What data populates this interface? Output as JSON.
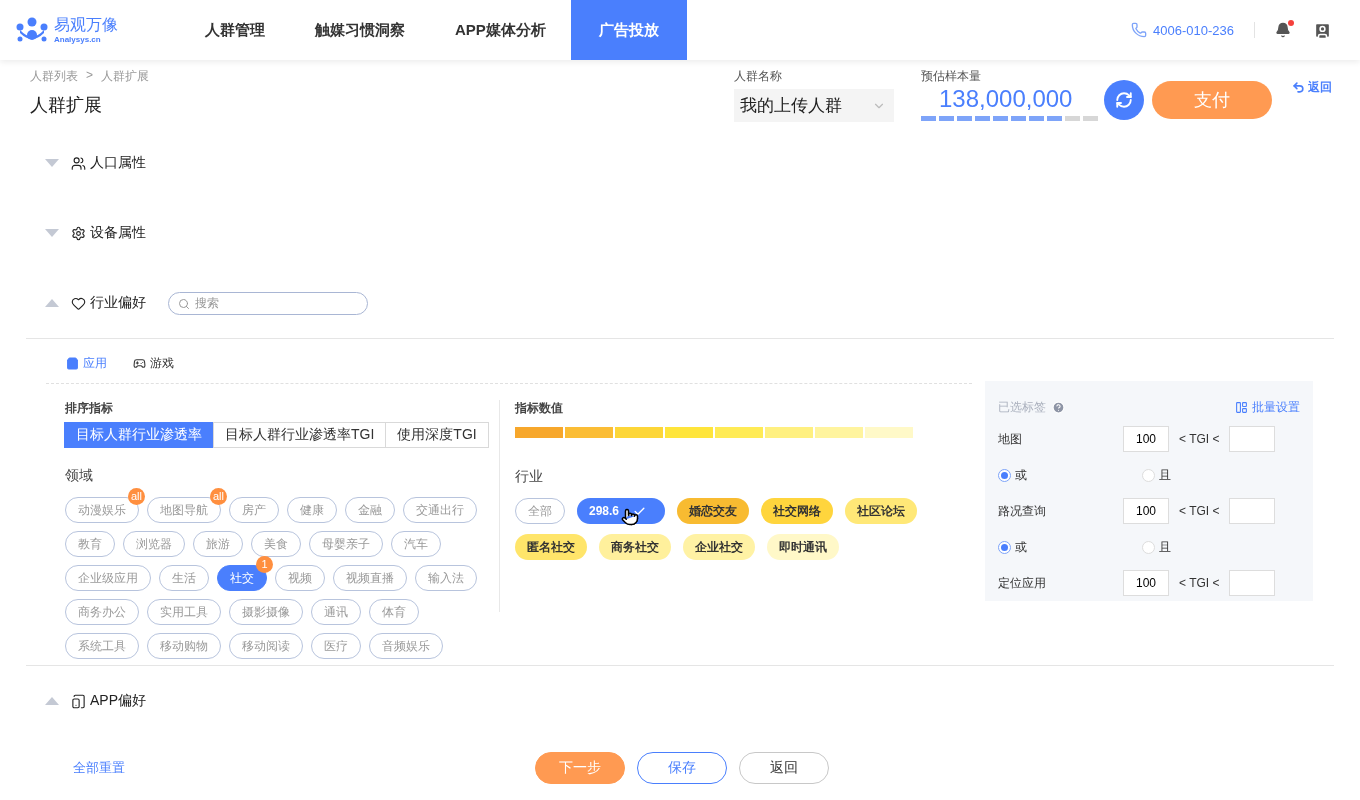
{
  "header": {
    "logo": {
      "name": "易观万像",
      "sub": "Analysys.cn"
    },
    "nav": [
      {
        "label": "人群管理",
        "selected": false
      },
      {
        "label": "触媒习惯洞察",
        "selected": false
      },
      {
        "label": "APP媒体分析",
        "selected": false
      },
      {
        "label": "广告投放",
        "selected": true
      }
    ],
    "phone": "4006-010-236",
    "unread": true
  },
  "breadcrumb": {
    "items": [
      "人群列表",
      "人群扩展"
    ],
    "separator": ">"
  },
  "title": "人群扩展",
  "audience": {
    "label": "人群名称",
    "value": "我的上传人群"
  },
  "estimate": {
    "label": "预估样本量",
    "value": "138,000,000",
    "level": 0.8
  },
  "pay_button": "支付",
  "back_link": "返回",
  "sections": [
    {
      "title": "人口属性",
      "expanded": false
    },
    {
      "title": "设备属性",
      "expanded": false
    },
    {
      "title": "行业偏好",
      "expanded": true,
      "search_placeholder": "搜索"
    },
    {
      "title": "APP偏好",
      "expanded": true
    }
  ],
  "industry": {
    "tabs": [
      {
        "label": "应用",
        "selected": true
      },
      {
        "label": "游戏",
        "selected": false
      }
    ],
    "sort_label": "排序指标",
    "sort_options": [
      {
        "label": "目标人群行业渗透率",
        "selected": true
      },
      {
        "label": "目标人群行业渗透率TGI",
        "selected": false
      },
      {
        "label": "使用深度TGI",
        "selected": false
      }
    ],
    "domain_label": "领域",
    "domains": [
      {
        "label": "动漫娱乐",
        "selected": false,
        "badge": "all"
      },
      {
        "label": "地图导航",
        "selected": false,
        "badge": "all"
      },
      {
        "label": "房产",
        "selected": false
      },
      {
        "label": "健康",
        "selected": false
      },
      {
        "label": "金融",
        "selected": false
      },
      {
        "label": "交通出行",
        "selected": false
      },
      {
        "label": "教育",
        "selected": false
      },
      {
        "label": "浏览器",
        "selected": false
      },
      {
        "label": "旅游",
        "selected": false
      },
      {
        "label": "美食",
        "selected": false
      },
      {
        "label": "母婴亲子",
        "selected": false
      },
      {
        "label": "汽车",
        "selected": false
      },
      {
        "label": "企业级应用",
        "selected": false
      },
      {
        "label": "生活",
        "selected": false
      },
      {
        "label": "社交",
        "selected": true,
        "badge": "1"
      },
      {
        "label": "视频",
        "selected": false
      },
      {
        "label": "视频直播",
        "selected": false
      },
      {
        "label": "输入法",
        "selected": false
      },
      {
        "label": "商务办公",
        "selected": false
      },
      {
        "label": "实用工具",
        "selected": false
      },
      {
        "label": "摄影摄像",
        "selected": false
      },
      {
        "label": "通讯",
        "selected": false
      },
      {
        "label": "体育",
        "selected": false
      },
      {
        "label": "系统工具",
        "selected": false
      },
      {
        "label": "移动购物",
        "selected": false
      },
      {
        "label": "移动阅读",
        "selected": false
      },
      {
        "label": "医疗",
        "selected": false
      },
      {
        "label": "音频娱乐",
        "selected": false
      }
    ],
    "metric_label": "指标数值",
    "scale": [
      {
        "color": "#f7a72b"
      },
      {
        "color": "#fbbd35"
      },
      {
        "color": "#fdd638"
      },
      {
        "color": "#ffe53b"
      },
      {
        "color": "#ffeb55"
      },
      {
        "color": "#fff080"
      },
      {
        "color": "#fff49e"
      },
      {
        "color": "#fff9c8"
      }
    ],
    "industry_label": "行业",
    "industries": [
      {
        "label": "全部",
        "kind": "all",
        "selected": false
      },
      {
        "label": "298.6",
        "kind": "tag",
        "selected": true
      },
      {
        "label": "婚恋交友",
        "kind": "tag",
        "selected": false,
        "color": "#f8bb31"
      },
      {
        "label": "社交网络",
        "kind": "tag",
        "selected": false,
        "color": "#ffd53d"
      },
      {
        "label": "社区论坛",
        "kind": "tag",
        "selected": false,
        "color": "#ffe877"
      },
      {
        "label": "匿名社交",
        "kind": "tag",
        "selected": false,
        "color": "#ffe56a"
      },
      {
        "label": "商务社交",
        "kind": "tag",
        "selected": false,
        "color": "#fff09c"
      },
      {
        "label": "企业社交",
        "kind": "tag",
        "selected": false,
        "color": "#fff2a4"
      },
      {
        "label": "即时通讯",
        "kind": "tag",
        "selected": false,
        "color": "#fff8c8"
      }
    ]
  },
  "selected_panel": {
    "title": "已选标签",
    "batch": "批量设置",
    "items": [
      {
        "kind": "tag",
        "label": "地图",
        "min": "100",
        "op": "< TGI <"
      },
      {
        "kind": "logic",
        "options": [
          {
            "label": "或",
            "selected": true
          },
          {
            "label": "且",
            "selected": false
          }
        ]
      },
      {
        "kind": "tag",
        "label": "路况查询",
        "min": "100",
        "op": "< TGI <"
      },
      {
        "kind": "logic",
        "options": [
          {
            "label": "或",
            "selected": true
          },
          {
            "label": "且",
            "selected": false
          }
        ]
      },
      {
        "kind": "tag",
        "label": "定位应用",
        "min": "100",
        "op": "< TGI <"
      }
    ]
  },
  "footer": {
    "reset": "全部重置",
    "buttons": [
      {
        "label": "下一步",
        "kind": "primary"
      },
      {
        "label": "保存",
        "kind": "outline"
      },
      {
        "label": "返回",
        "kind": "plain"
      }
    ]
  }
}
